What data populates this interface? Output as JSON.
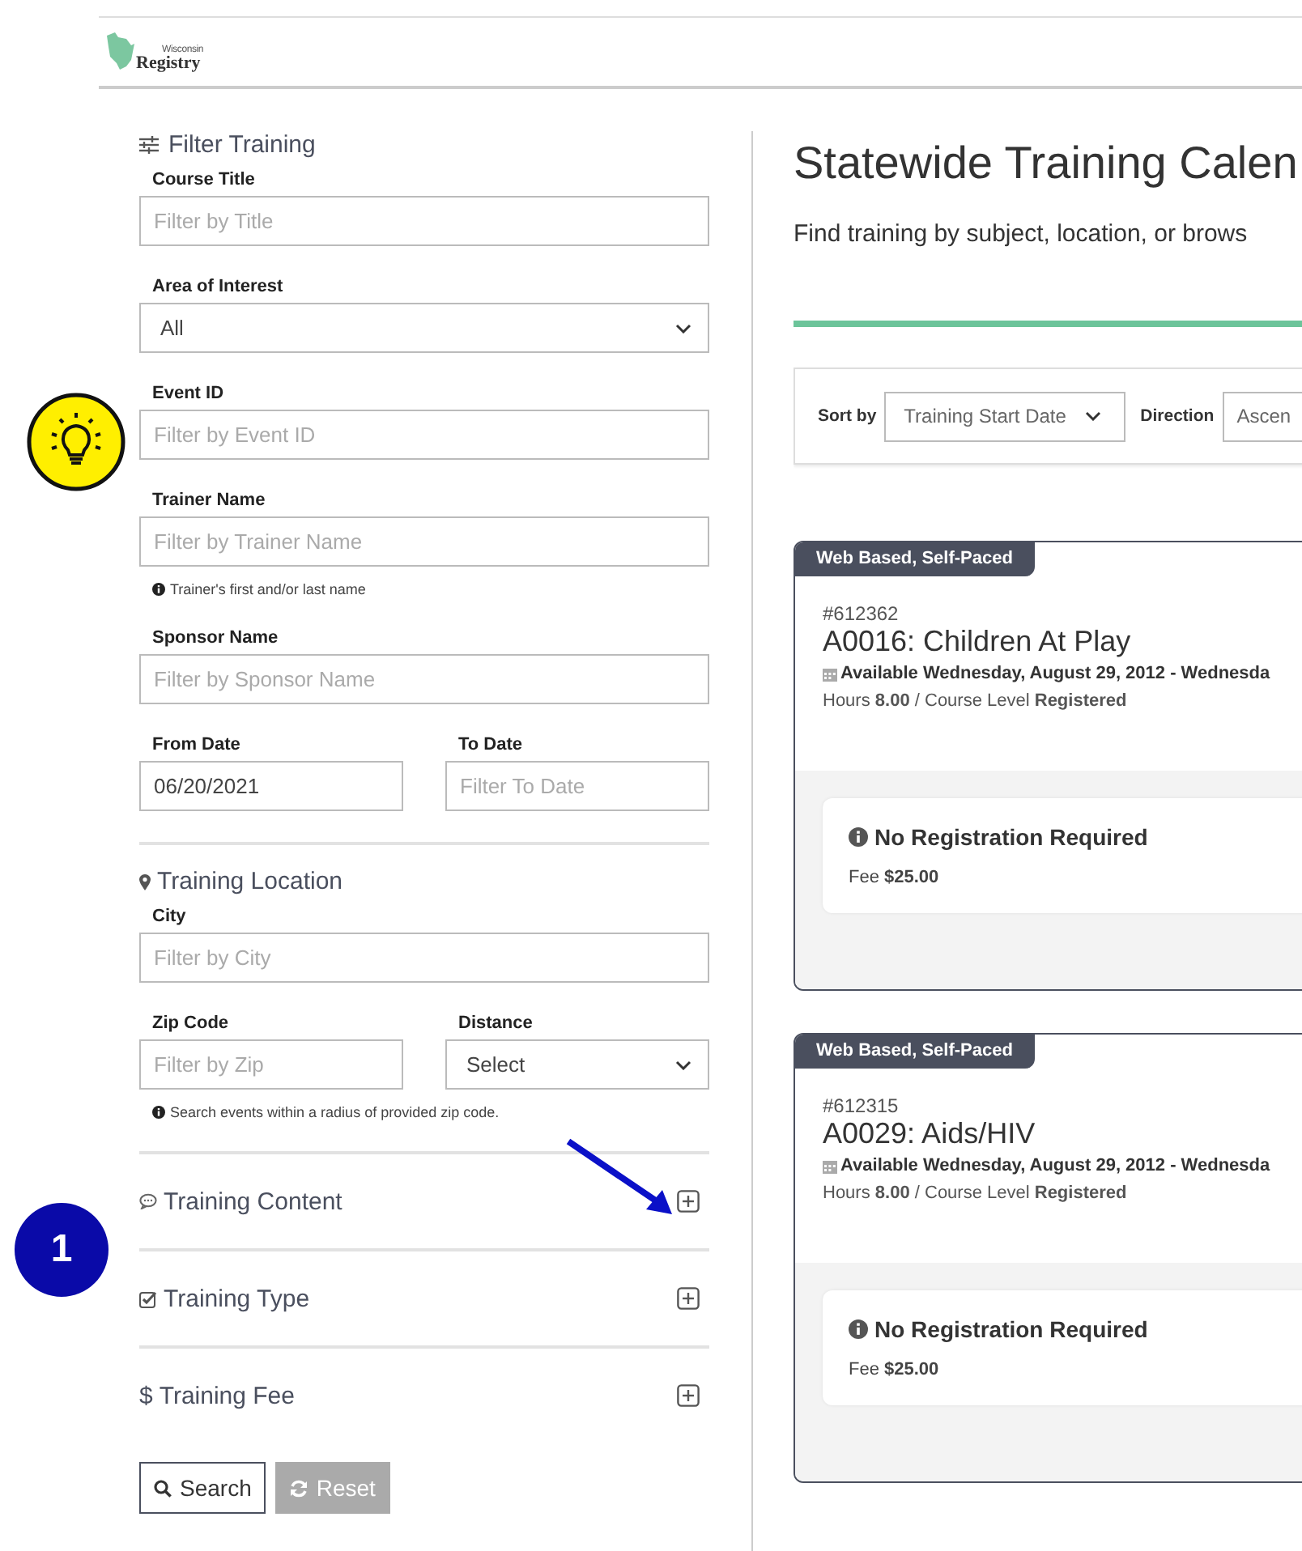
{
  "logo": {
    "small": "Wisconsin",
    "large": "Registry"
  },
  "filter": {
    "title": "Filter Training",
    "rows": [
      {
        "fields": [
          {
            "label": "Course Title",
            "kind": "input",
            "placeholder": "Filter by Title"
          }
        ]
      },
      {
        "fields": [
          {
            "label": "Area of Interest",
            "kind": "select",
            "value": "All"
          }
        ]
      },
      {
        "fields": [
          {
            "label": "Event ID",
            "kind": "input",
            "placeholder": "Filter by Event ID"
          }
        ]
      },
      {
        "fields": [
          {
            "label": "Trainer Name",
            "kind": "input",
            "placeholder": "Filter by Trainer Name"
          }
        ],
        "hint": "Trainer's first and/or last name"
      },
      {
        "fields": [
          {
            "label": "Sponsor Name",
            "kind": "input",
            "placeholder": "Filter by Sponsor Name"
          }
        ]
      },
      {
        "fields": [
          {
            "label": "From Date",
            "kind": "input",
            "value": "06/20/2021"
          },
          {
            "label": "To Date",
            "kind": "input",
            "placeholder": "Filter To Date"
          }
        ]
      }
    ]
  },
  "location": {
    "title": "Training Location",
    "rows": [
      {
        "fields": [
          {
            "label": "City",
            "kind": "input",
            "placeholder": "Filter by City"
          }
        ]
      },
      {
        "fields": [
          {
            "label": "Zip Code",
            "kind": "input",
            "placeholder": "Filter by Zip"
          },
          {
            "label": "Distance",
            "kind": "select",
            "value": "Select"
          }
        ],
        "hint": "Search events within a radius of provided zip code."
      }
    ]
  },
  "collapsibles": [
    {
      "label": "Training Content",
      "kind": "comment",
      "expanded": false
    },
    {
      "label": "Training Type",
      "kind": "check",
      "expanded": false
    },
    {
      "label": "Training Fee",
      "kind": "dollar",
      "icon": "$",
      "expanded": false
    }
  ],
  "buttons": [
    {
      "label": "Search",
      "kind": "search",
      "disabled": false
    },
    {
      "label": "Reset",
      "kind": "reset",
      "disabled": true
    }
  ],
  "main": {
    "title": "Statewide Training Calen",
    "subtitle": "Find training by subject, location, or brows",
    "sort": {
      "label": "Sort by",
      "value": "Training Start Date"
    },
    "direction": {
      "label": "Direction",
      "value": "Ascen"
    }
  },
  "cards": [
    {
      "tag": "Web Based, Self-Paced",
      "number": "#612362",
      "title": "A0016: Children At Play",
      "dates": "Available Wednesday, August 29, 2012 - Wednesda",
      "details": "Hours **8.00** / Course Level **Registered**",
      "registration": "No Registration Required",
      "fee": "Fee **$25.00**"
    },
    {
      "tag": "Web Based, Self-Paced",
      "number": "#612315",
      "title": "A0029: Aids/HIV",
      "dates": "Available Wednesday, August 29, 2012 - Wednesda",
      "details": "Hours **8.00** / Course Level **Registered**",
      "registration": "No Registration Required",
      "fee": "Fee **$25.00**"
    }
  ],
  "callout": {
    "number": "1"
  }
}
